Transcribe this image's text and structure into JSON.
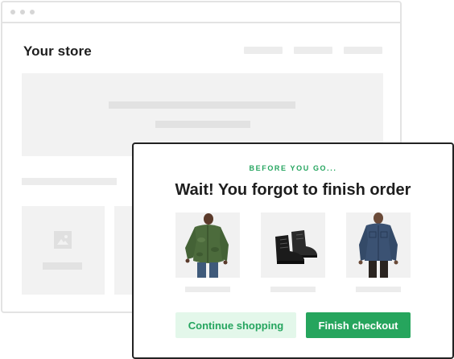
{
  "store": {
    "title": "Your store"
  },
  "popup": {
    "eyebrow": "BEFORE YOU GO...",
    "headline": "Wait! You forgot to finish order",
    "products": [
      {
        "icon": "green-jacket-image"
      },
      {
        "icon": "black-boots-image"
      },
      {
        "icon": "denim-shirt-image"
      }
    ],
    "buttons": {
      "continue_label": "Continue shopping",
      "finish_label": "Finish checkout"
    }
  },
  "colors": {
    "accent_green": "#26a55d",
    "accent_green_light": "#e3f7ea",
    "placeholder_gray": "#f2f2f2"
  }
}
